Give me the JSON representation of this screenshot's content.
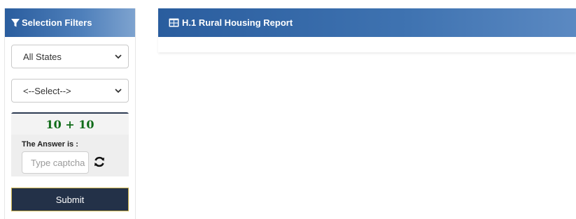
{
  "sidebar": {
    "title": "Selection Filters",
    "title_icon": "filter-icon",
    "state_select": {
      "value": "All States"
    },
    "secondary_select": {
      "value": "<--Select-->"
    },
    "captcha": {
      "question": "10 + 10",
      "label": "The Answer is :",
      "placeholder": "Type captcha",
      "refresh_icon": "refresh-icon"
    },
    "submit_label": "Submit"
  },
  "report": {
    "title": "H.1 Rural Housing Report",
    "title_icon": "table-icon"
  },
  "colors": {
    "header_blue": "#2a5d9e",
    "submit_bg": "#233148",
    "captcha_green": "#0f6b18"
  }
}
